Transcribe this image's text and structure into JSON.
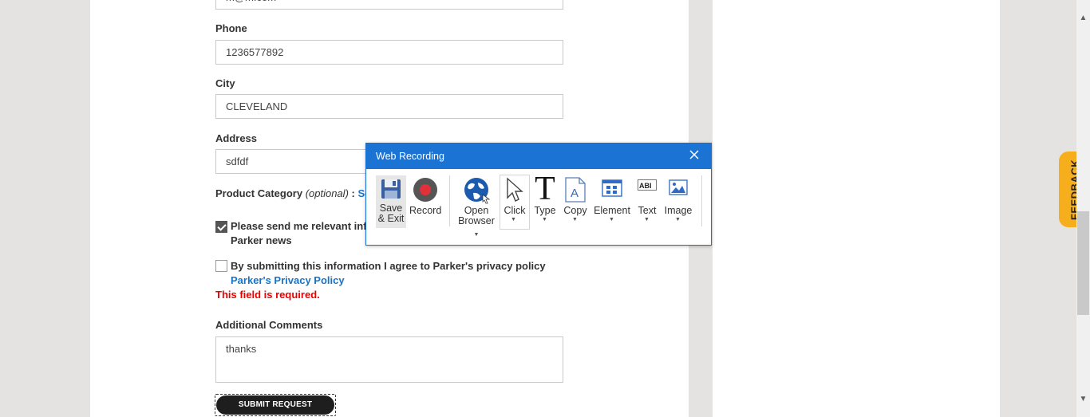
{
  "form": {
    "email_value": "m@m.com",
    "phone_label": "Phone",
    "phone_value": "1236577892",
    "city_label": "City",
    "city_value": "CLEVELAND",
    "address_label": "Address",
    "address_value": "sdfdf",
    "category_label": "Product Category",
    "category_optional": "(optional)",
    "category_colon": " : ",
    "category_select": "Sele",
    "consent1_text": "Please send me relevant infor",
    "consent1_text2": "Parker news",
    "consent1_checked": true,
    "consent2_text": "By submitting this information I agree to Parker's privacy policy",
    "consent2_checked": false,
    "privacy_link": "Parker's Privacy Policy",
    "error_text": "This field is required.",
    "comments_label": "Additional Comments",
    "comments_value": "thanks",
    "submit_label": "SUBMIT REQUEST"
  },
  "feedback_tab": "FEEDBACK",
  "recorder": {
    "title": "Web Recording",
    "tools": {
      "save": "Save\n& Exit",
      "save_line1": "Save",
      "save_line2": "& Exit",
      "record": "Record",
      "open_line1": "Open",
      "open_line2": "Browser",
      "click": "Click",
      "type": "Type",
      "copy": "Copy",
      "element": "Element",
      "text": "Text",
      "image": "Image"
    },
    "colors": {
      "header": "#1b73d4",
      "record": "#e0313b"
    }
  }
}
